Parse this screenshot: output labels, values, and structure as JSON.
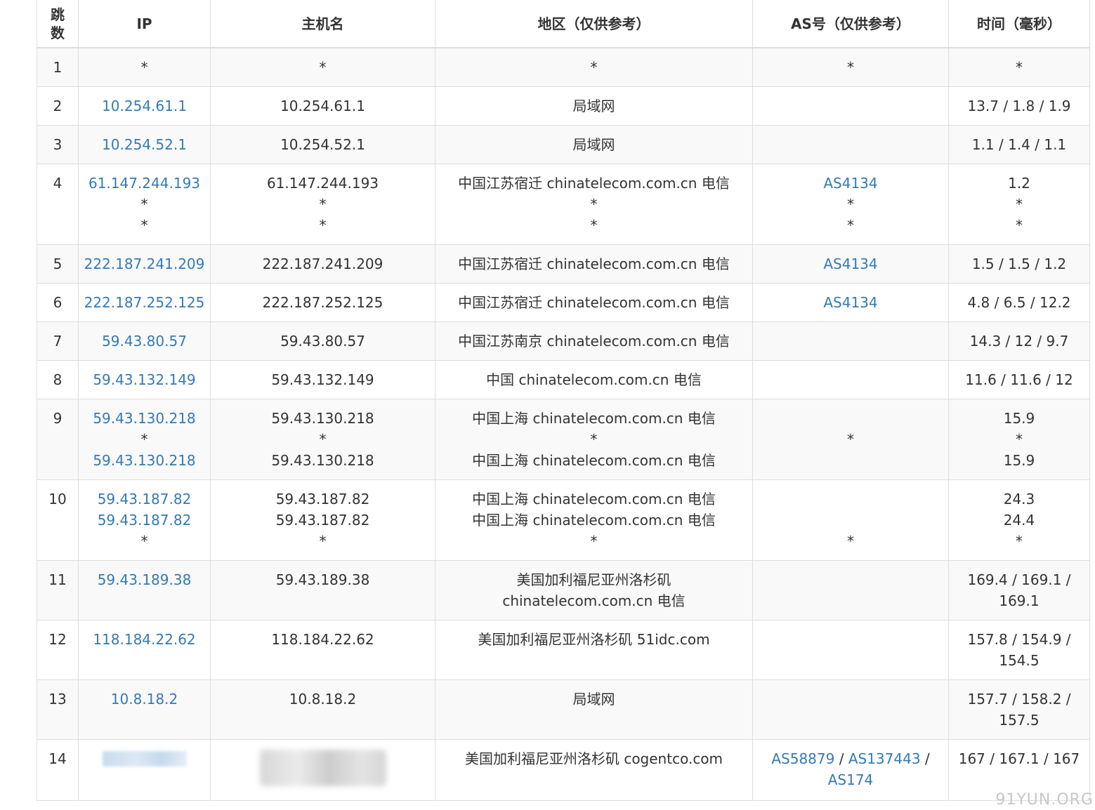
{
  "headers": {
    "hop": "跳数",
    "ip": "IP",
    "host": "主机名",
    "region": "地区（仅供参考）",
    "as": "AS号（仅供参考）",
    "time": "时间（毫秒）"
  },
  "star": "*",
  "rows": [
    {
      "hop": "1",
      "ip": [
        "*"
      ],
      "host": [
        "*"
      ],
      "region": [
        "*"
      ],
      "as": [
        "*"
      ],
      "time": [
        "*"
      ]
    },
    {
      "hop": "2",
      "ip": [
        "10.254.61.1"
      ],
      "host": [
        "10.254.61.1"
      ],
      "region": [
        "局域网"
      ],
      "as": [],
      "time": [
        "13.7 / 1.8 / 1.9"
      ]
    },
    {
      "hop": "3",
      "ip": [
        "10.254.52.1"
      ],
      "host": [
        "10.254.52.1"
      ],
      "region": [
        "局域网"
      ],
      "as": [],
      "time": [
        "1.1 / 1.4 / 1.1"
      ]
    },
    {
      "hop": "4",
      "ip": [
        "61.147.244.193",
        "*",
        "*"
      ],
      "host": [
        "61.147.244.193",
        "*",
        "*"
      ],
      "region": [
        "中国江苏宿迁 chinatelecom.com.cn 电信",
        "*",
        "*"
      ],
      "as": [
        "AS4134",
        "*",
        "*"
      ],
      "time": [
        "1.2",
        "*",
        "*"
      ]
    },
    {
      "hop": "5",
      "ip": [
        "222.187.241.209"
      ],
      "host": [
        "222.187.241.209"
      ],
      "region": [
        "中国江苏宿迁 chinatelecom.com.cn 电信"
      ],
      "as": [
        "AS4134"
      ],
      "time": [
        "1.5 / 1.5 / 1.2"
      ]
    },
    {
      "hop": "6",
      "ip": [
        "222.187.252.125"
      ],
      "host": [
        "222.187.252.125"
      ],
      "region": [
        "中国江苏宿迁 chinatelecom.com.cn 电信"
      ],
      "as": [
        "AS4134"
      ],
      "time": [
        "4.8 / 6.5 / 12.2"
      ]
    },
    {
      "hop": "7",
      "ip": [
        "59.43.80.57"
      ],
      "host": [
        "59.43.80.57"
      ],
      "region": [
        "中国江苏南京 chinatelecom.com.cn 电信"
      ],
      "as": [],
      "time": [
        "14.3 / 12 / 9.7"
      ]
    },
    {
      "hop": "8",
      "ip": [
        "59.43.132.149"
      ],
      "host": [
        "59.43.132.149"
      ],
      "region": [
        "中国 chinatelecom.com.cn 电信"
      ],
      "as": [],
      "time": [
        "11.6 / 11.6 / 12"
      ]
    },
    {
      "hop": "9",
      "ip": [
        "59.43.130.218",
        "*",
        "59.43.130.218"
      ],
      "host": [
        "59.43.130.218",
        "*",
        "59.43.130.218"
      ],
      "region": [
        "中国上海 chinatelecom.com.cn 电信",
        "*",
        "中国上海 chinatelecom.com.cn 电信"
      ],
      "as": [
        "",
        "*",
        ""
      ],
      "time": [
        "15.9",
        "*",
        "15.9"
      ]
    },
    {
      "hop": "10",
      "ip": [
        "59.43.187.82",
        "59.43.187.82",
        "*"
      ],
      "host": [
        "59.43.187.82",
        "59.43.187.82",
        "*"
      ],
      "region": [
        "中国上海 chinatelecom.com.cn 电信",
        "中国上海 chinatelecom.com.cn 电信",
        "*"
      ],
      "as": [
        "",
        "",
        "*"
      ],
      "time": [
        "24.3",
        "24.4",
        "*"
      ]
    },
    {
      "hop": "11",
      "ip": [
        "59.43.189.38"
      ],
      "host": [
        "59.43.189.38"
      ],
      "region": [
        "美国加利福尼亚州洛杉矶",
        "chinatelecom.com.cn 电信"
      ],
      "as": [],
      "time": [
        "169.4 / 169.1 /",
        "169.1"
      ]
    },
    {
      "hop": "12",
      "ip": [
        "118.184.22.62"
      ],
      "host": [
        "118.184.22.62"
      ],
      "region": [
        "美国加利福尼亚州洛杉矶 51idc.com"
      ],
      "as": [],
      "time": [
        "157.8 / 154.9 /",
        "154.5"
      ]
    },
    {
      "hop": "13",
      "ip": [
        "10.8.18.2"
      ],
      "host": [
        "10.8.18.2"
      ],
      "region": [
        "局域网"
      ],
      "as": [],
      "time": [
        "157.7 / 158.2 /",
        "157.5"
      ]
    },
    {
      "hop": "14",
      "ip": [
        "__blur_ip__"
      ],
      "host": [
        "__blur_host__"
      ],
      "region": [
        "美国加利福尼亚州洛杉矶 cogentco.com"
      ],
      "as": [
        "AS58879 / AS137443 /",
        "AS174"
      ],
      "time": [
        "167 / 167.1 / 167"
      ]
    }
  ],
  "as14": {
    "a": "AS58879",
    "b": "AS137443",
    "c": "AS174",
    "slash": "/"
  },
  "watermark": "91YUN.ORG"
}
